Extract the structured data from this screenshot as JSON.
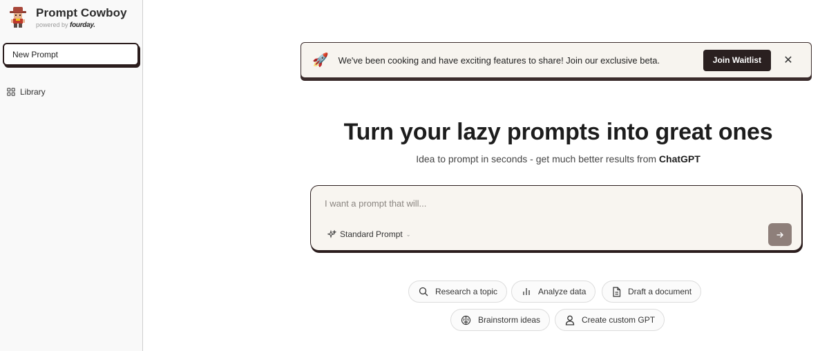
{
  "sidebar": {
    "brand_name": "Prompt Cowboy",
    "powered_by": "powered by",
    "powered_brand": "fourday.",
    "new_prompt_label": "New Prompt",
    "library_label": "Library"
  },
  "banner": {
    "icon": "rocket-icon",
    "text": "We've been cooking and have exciting features to share! Join our exclusive beta.",
    "button_label": "Join Waitlist",
    "close_symbol": "✕"
  },
  "hero": {
    "title": "Turn your lazy prompts into great ones",
    "subtitle_prefix": "Idea to prompt in seconds - get much better results from ",
    "subtitle_bold": "ChatGPT"
  },
  "prompt": {
    "placeholder": "I want a prompt that will...",
    "value": "",
    "type_label": "Standard Prompt"
  },
  "suggestions": [
    {
      "label": "Research a topic",
      "icon": "search-icon"
    },
    {
      "label": "Analyze data",
      "icon": "bar-chart-icon"
    },
    {
      "label": "Draft a document",
      "icon": "document-icon"
    },
    {
      "label": "Brainstorm ideas",
      "icon": "brain-icon"
    },
    {
      "label": "Create custom GPT",
      "icon": "user-icon"
    }
  ],
  "colors": {
    "accent_dark": "#2a2020",
    "send_button": "#8e7f7a",
    "banner_bg": "#f7f4ef",
    "prompt_bg": "#f8f5f0"
  }
}
